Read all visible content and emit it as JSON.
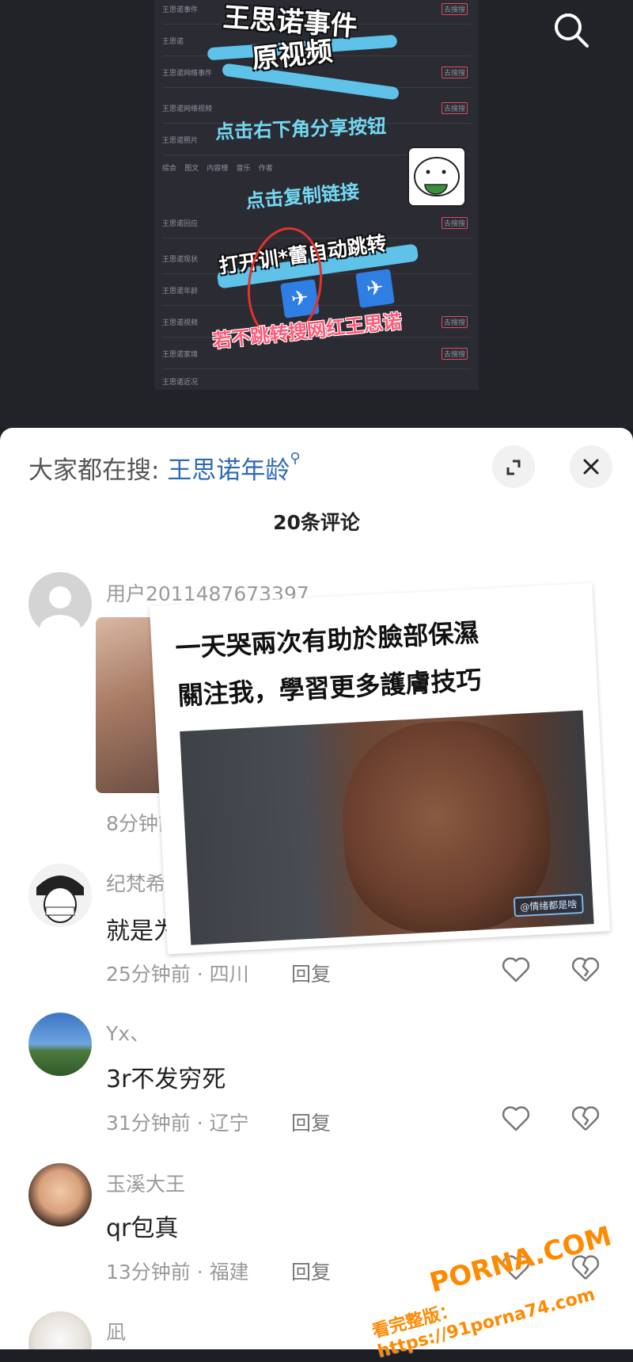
{
  "video": {
    "title_line1": "王思诺事件",
    "title_line2": "原视频",
    "step1": "点击右下角分享按钮",
    "step2": "点击复制链接",
    "step3": "打开训*蕾自动跳转",
    "step4": "若不跳转搜网红王思诺",
    "tabs": [
      "综合",
      "图文",
      "内容榜",
      "音乐",
      "作者"
    ],
    "list_items": [
      "王思诺事件",
      "王思诺",
      "王思诺网络事件",
      "王思诺网络视频",
      "王思诺照片",
      "王思诺回应",
      "王思诺现状",
      "王思诺年龄",
      "王思诺视频",
      "王思诺家境",
      "王思诺近况"
    ],
    "badge_label": "去搜搜"
  },
  "panel": {
    "search_prefix": "大家都在搜:",
    "search_term": "王思诺年龄",
    "comment_count": "20条评论"
  },
  "comments": [
    {
      "user": "用户2011487673397",
      "text": "",
      "time": "8分钟前",
      "location": "",
      "reply": ""
    },
    {
      "user": "纪梵希",
      "text": "就是为",
      "time": "25分钟前",
      "location": "四川",
      "reply": "回复"
    },
    {
      "user": "Yx、",
      "text": "3r不发穷死",
      "time": "31分钟前",
      "location": "辽宁",
      "reply": "回复"
    },
    {
      "user": "玉溪大王",
      "text": "qr包真",
      "time": "13分钟前",
      "location": "福建",
      "reply": "回复"
    },
    {
      "user": "凪",
      "text": "",
      "time": "",
      "location": "",
      "reply": ""
    }
  ],
  "meme": {
    "line1": "一天哭兩次有助於臉部保濕",
    "line2": "關注我，學習更多護膚技巧",
    "tag": "@情绪都是啥"
  },
  "watermark": {
    "brand": "PORNA.COM",
    "line": "看完整版：https://91porna74.com"
  },
  "icons": [
    "search-icon",
    "expand-icon",
    "close-icon",
    "heart-icon",
    "broken-heart-icon"
  ]
}
